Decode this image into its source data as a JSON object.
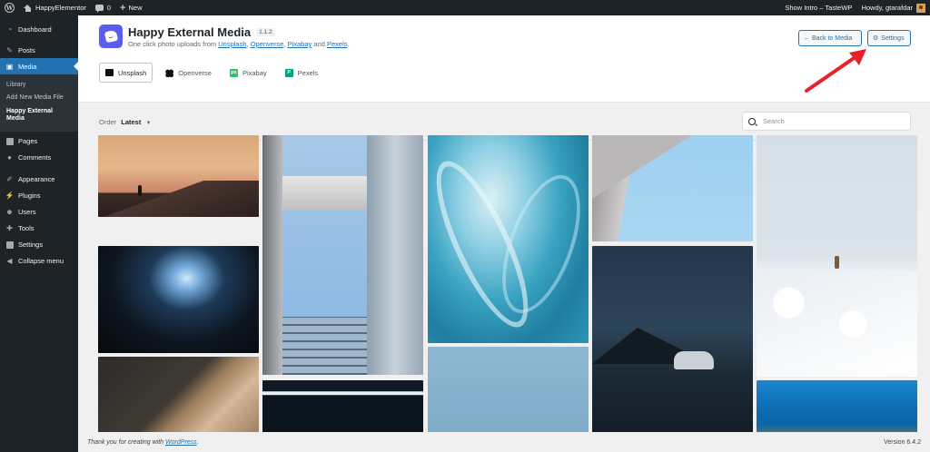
{
  "adminbar": {
    "site_name": "HappyElementor",
    "comments_count": "0",
    "new_label": "New",
    "show_intro": "Show Intro – TasteWP",
    "howdy": "Howdy, gtarafdar"
  },
  "sidebar": {
    "items": [
      {
        "label": "Dashboard",
        "icon": "dashboard-icon"
      },
      {
        "label": "Posts",
        "icon": "pin-icon"
      },
      {
        "label": "Media",
        "icon": "media-icon"
      },
      {
        "label": "Pages",
        "icon": "pages-icon"
      },
      {
        "label": "Comments",
        "icon": "comments-icon"
      },
      {
        "label": "Appearance",
        "icon": "brush-icon"
      },
      {
        "label": "Plugins",
        "icon": "plugin-icon"
      },
      {
        "label": "Users",
        "icon": "users-icon"
      },
      {
        "label": "Tools",
        "icon": "wrench-icon"
      },
      {
        "label": "Settings",
        "icon": "settings-icon"
      },
      {
        "label": "Collapse menu",
        "icon": "collapse-icon"
      }
    ],
    "media_submenu": [
      "Library",
      "Add New Media File",
      "Happy External Media"
    ]
  },
  "header": {
    "title": "Happy External Media",
    "version": "1.1.2",
    "subtitle_prefix": "One click photo uploads from",
    "sources": [
      "Unsplash",
      "Openverse",
      "Pixabay",
      "Pexels"
    ],
    "sep_comma": ",",
    "sep_and": "and",
    "back_button": "← Back to Media",
    "settings_button": "Settings"
  },
  "tabs": [
    {
      "label": "Unsplash",
      "active": true
    },
    {
      "label": "Openverse",
      "active": false
    },
    {
      "label": "Pixabay",
      "active": false,
      "icon_text": "px"
    },
    {
      "label": "Pexels",
      "active": false,
      "icon_text": "P"
    }
  ],
  "toolbar": {
    "order_label": "Order",
    "order_value": "Latest",
    "search_placeholder": "Search"
  },
  "footer": {
    "thanks_prefix": "Thank you for creating with",
    "wordpress_link": "WordPress",
    "thanks_suffix": ".",
    "version": "Version 6.4.2"
  },
  "colors": {
    "accent": "#2271b1",
    "admin_bar": "#1d2327",
    "annotation_arrow": "#e8202a",
    "plugin_logo": "#5a5df0"
  }
}
